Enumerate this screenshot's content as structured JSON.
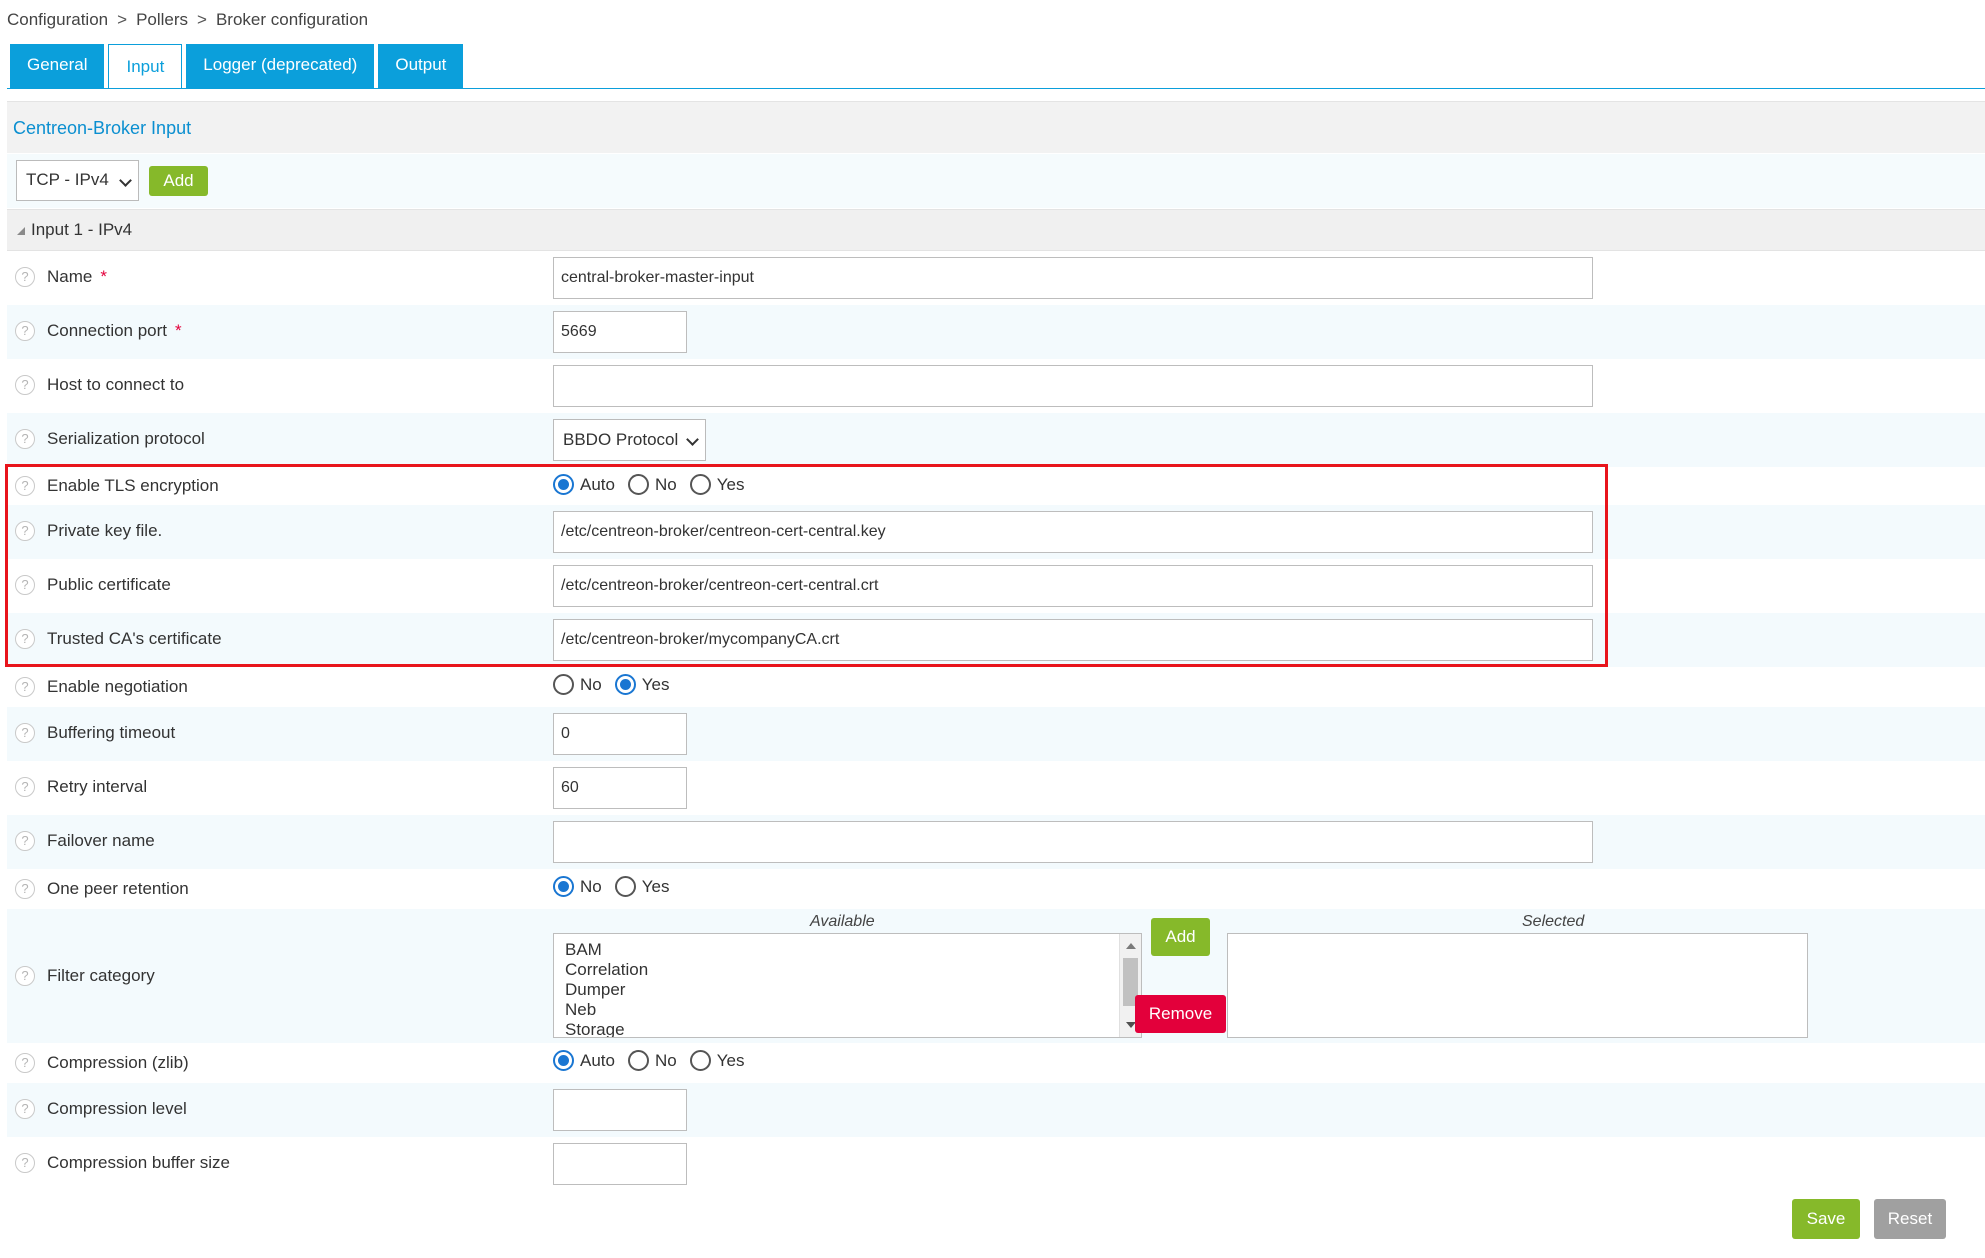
{
  "breadcrumb": [
    "Configuration",
    "Pollers",
    "Broker configuration"
  ],
  "breadcrumb_sep": ">",
  "tabs": [
    {
      "label": "General",
      "active": false
    },
    {
      "label": "Input",
      "active": true
    },
    {
      "label": "Logger (deprecated)",
      "active": false
    },
    {
      "label": "Output",
      "active": false
    }
  ],
  "section_title": "Centreon-Broker Input",
  "add_row": {
    "type_value": "TCP - IPv4",
    "add_label": "Add"
  },
  "group_title": "Input 1 - IPv4",
  "fields": {
    "name": {
      "label": "Name",
      "required": "*",
      "value": "central-broker-master-input"
    },
    "port": {
      "label": "Connection port",
      "required": "*",
      "value": "5669"
    },
    "host": {
      "label": "Host to connect to",
      "value": ""
    },
    "serialization": {
      "label": "Serialization protocol",
      "value": "BBDO Protocol"
    },
    "tls": {
      "label": "Enable TLS encryption",
      "options": [
        "Auto",
        "No",
        "Yes"
      ],
      "selected": "Auto"
    },
    "private_key": {
      "label": "Private key file.",
      "value": "/etc/centreon-broker/centreon-cert-central.key"
    },
    "public_cert": {
      "label": "Public certificate",
      "value": "/etc/centreon-broker/centreon-cert-central.crt"
    },
    "ca_cert": {
      "label": "Trusted CA's certificate",
      "value": "/etc/centreon-broker/mycompanyCA.crt"
    },
    "negotiation": {
      "label": "Enable negotiation",
      "options": [
        "No",
        "Yes"
      ],
      "selected": "Yes"
    },
    "buffering": {
      "label": "Buffering timeout",
      "value": "0"
    },
    "retry": {
      "label": "Retry interval",
      "value": "60"
    },
    "failover": {
      "label": "Failover name",
      "value": ""
    },
    "one_peer": {
      "label": "One peer retention",
      "options": [
        "No",
        "Yes"
      ],
      "selected": "No"
    },
    "filter": {
      "label": "Filter category",
      "available_title": "Available",
      "selected_title": "Selected",
      "available": [
        "BAM",
        "Correlation",
        "Dumper",
        "Neb",
        "Storage"
      ],
      "selected": [],
      "add_label": "Add",
      "remove_label": "Remove"
    },
    "compression": {
      "label": "Compression (zlib)",
      "options": [
        "Auto",
        "No",
        "Yes"
      ],
      "selected": "Auto"
    },
    "compression_level": {
      "label": "Compression level",
      "value": ""
    },
    "compression_buffer": {
      "label": "Compression buffer size",
      "value": ""
    }
  },
  "footer": {
    "save_label": "Save",
    "reset_label": "Reset"
  },
  "colors": {
    "accent": "#0b9fdb",
    "green": "#86b92a",
    "red": "#e3003b",
    "highlight": "#e8141c"
  }
}
